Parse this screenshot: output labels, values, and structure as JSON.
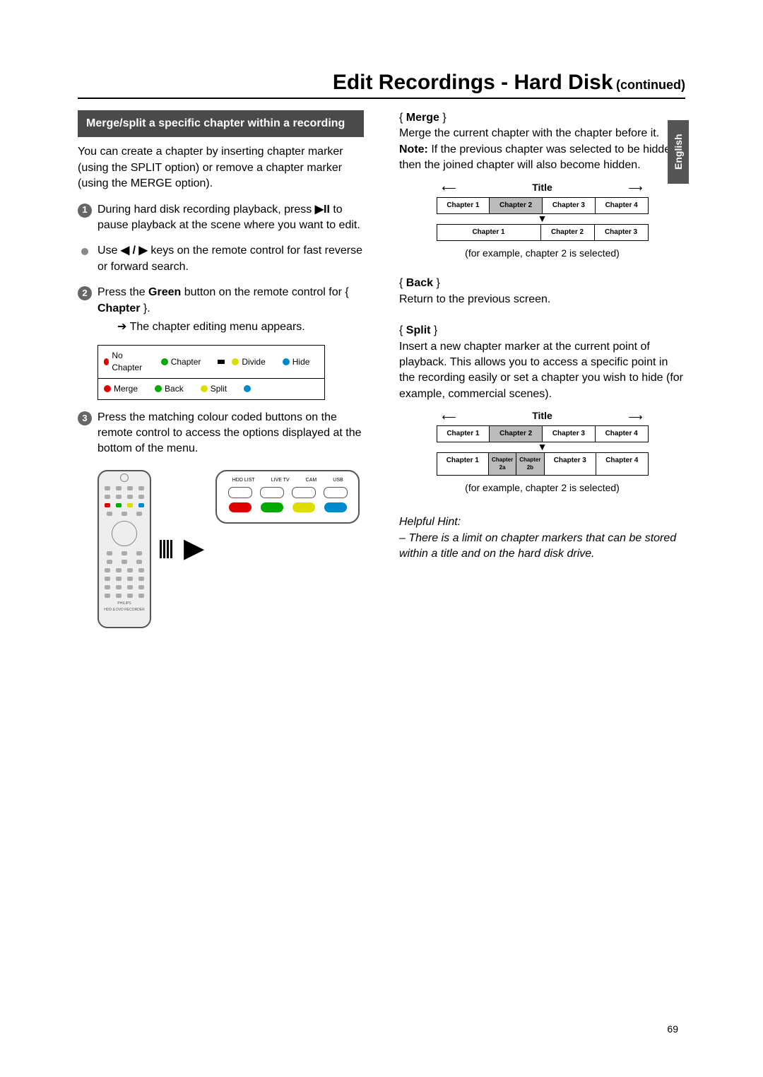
{
  "header": {
    "title": "Edit Recordings - Hard Disk",
    "continued": "(continued)"
  },
  "language": "English",
  "left": {
    "section_title": "Merge/split a specific chapter within a recording",
    "intro": "You can create a chapter by inserting chapter marker (using the SPLIT option) or remove a chapter marker (using the MERGE option).",
    "step1_pre": "During hard disk recording playback, press ",
    "step1_post": " to pause playback at the scene where you want to edit.",
    "bullet_pre": "Use ",
    "bullet_post": " keys on the remote control for fast reverse or forward search.",
    "step2_pre": "Press the ",
    "step2_green": "Green",
    "step2_mid": " button on the remote control for { ",
    "step2_chapter": "Chapter",
    "step2_post": " }.",
    "step2_sub": "The chapter editing menu appears.",
    "menu_top": {
      "no_chapter": "No Chapter",
      "chapter": "Chapter",
      "divide": "Divide",
      "hide": "Hide"
    },
    "menu_bottom": {
      "merge": "Merge",
      "back": "Back",
      "split": "Split"
    },
    "step3": "Press the matching colour coded buttons on the remote control to access the options displayed at the bottom of the menu.",
    "pad_labels": [
      "HDD LIST",
      "LIVE TV",
      "CAM",
      "USB"
    ],
    "remote_brand": "PHILIPS",
    "remote_model": "HDD & DVD RECORDER"
  },
  "right": {
    "merge_label": "Merge",
    "merge_text": "Merge the current chapter with the chapter before it.",
    "merge_note_label": "Note:",
    "merge_note": " If the previous chapter was selected to be hidden, then the joined chapter will also become hidden.",
    "diagram_title": "Title",
    "row_before": [
      "Chapter 1",
      "Chapter 2",
      "Chapter 3",
      "Chapter 4"
    ],
    "merge_after": [
      {
        "label": "Chapter 1",
        "flex": 2
      },
      {
        "label": "Chapter 2",
        "flex": 1
      },
      {
        "label": "Chapter 3",
        "flex": 1
      }
    ],
    "example": "(for example, chapter 2 is selected)",
    "back_label": "Back",
    "back_text": "Return to the previous screen.",
    "split_label": "Split",
    "split_text": "Insert a new chapter marker at the current point of playback. This allows you to access a specific point in the recording easily or set a chapter you wish to hide (for example, commercial scenes).",
    "split_after": [
      "Chapter 1",
      "Chapter 2a",
      "Chapter 2b",
      "Chapter 3",
      "Chapter 4"
    ],
    "hint_label": "Helpful Hint:",
    "hint_text": "– There is a limit on chapter markers that can be stored within a title and on the hard disk drive."
  },
  "page_number": "69"
}
